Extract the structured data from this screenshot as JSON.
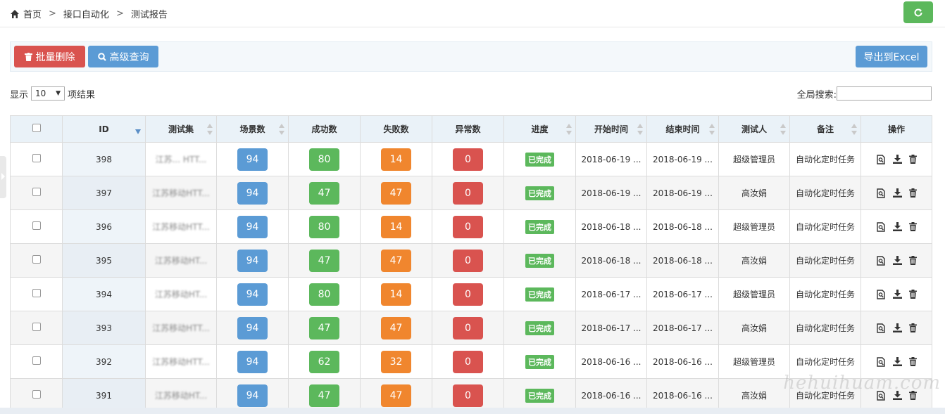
{
  "breadcrumb": {
    "home": "首页",
    "level1": "接口自动化",
    "level2": "测试报告",
    "separator": ">"
  },
  "toolbar": {
    "batch_delete": "批量删除",
    "advanced_query": "高级查询",
    "export_excel": "导出到Excel"
  },
  "length": {
    "prefix": "显示",
    "value": "10",
    "suffix": "项结果"
  },
  "search": {
    "label": "全局搜索:",
    "value": ""
  },
  "colors": {
    "blue": "#5b9bd5",
    "green": "#5cb85c",
    "orange": "#f0862e",
    "red": "#d9534f"
  },
  "table": {
    "headers": [
      "ID",
      "测试集",
      "场景数",
      "成功数",
      "失败数",
      "异常数",
      "进度",
      "开始时间",
      "结束时间",
      "测试人",
      "备注",
      "操作"
    ],
    "rows": [
      {
        "id": "398",
        "suite": "江苏... HTT...",
        "scenes": "94",
        "success": "80",
        "fail": "14",
        "error": "0",
        "status": "已完成",
        "start": "2018-06-19 ...",
        "end": "2018-06-19 ...",
        "tester": "超级管理员",
        "remark": "自动化定时任务"
      },
      {
        "id": "397",
        "suite": "江苏移动HTT...",
        "scenes": "94",
        "success": "47",
        "fail": "47",
        "error": "0",
        "status": "已完成",
        "start": "2018-06-19 ...",
        "end": "2018-06-19 ...",
        "tester": "高汝娟",
        "remark": "自动化定时任务"
      },
      {
        "id": "396",
        "suite": "江苏移动HTT...",
        "scenes": "94",
        "success": "80",
        "fail": "14",
        "error": "0",
        "status": "已完成",
        "start": "2018-06-18 ...",
        "end": "2018-06-18 ...",
        "tester": "超级管理员",
        "remark": "自动化定时任务"
      },
      {
        "id": "395",
        "suite": "江苏移动HT...",
        "scenes": "94",
        "success": "47",
        "fail": "47",
        "error": "0",
        "status": "已完成",
        "start": "2018-06-18 ...",
        "end": "2018-06-18 ...",
        "tester": "高汝娟",
        "remark": "自动化定时任务"
      },
      {
        "id": "394",
        "suite": "江苏移动HT...",
        "scenes": "94",
        "success": "80",
        "fail": "14",
        "error": "0",
        "status": "已完成",
        "start": "2018-06-17 ...",
        "end": "2018-06-17 ...",
        "tester": "超级管理员",
        "remark": "自动化定时任务"
      },
      {
        "id": "393",
        "suite": "江苏移动HTT...",
        "scenes": "94",
        "success": "47",
        "fail": "47",
        "error": "0",
        "status": "已完成",
        "start": "2018-06-17 ...",
        "end": "2018-06-17 ...",
        "tester": "高汝娟",
        "remark": "自动化定时任务"
      },
      {
        "id": "392",
        "suite": "江苏移动HTT...",
        "scenes": "94",
        "success": "62",
        "fail": "32",
        "error": "0",
        "status": "已完成",
        "start": "2018-06-16 ...",
        "end": "2018-06-16 ...",
        "tester": "超级管理员",
        "remark": "自动化定时任务"
      },
      {
        "id": "391",
        "suite": "江苏移动HT...",
        "scenes": "94",
        "success": "47",
        "fail": "47",
        "error": "0",
        "status": "已完成",
        "start": "2018-06-16 ...",
        "end": "2018-06-16 ...",
        "tester": "高汝娟",
        "remark": "自动化定时任务"
      }
    ]
  },
  "icons": {
    "home": "home-icon",
    "refresh": "refresh-icon",
    "trash": "trash-icon",
    "search": "search-icon",
    "view": "view-report-icon",
    "download": "download-icon",
    "delete": "delete-icon"
  },
  "watermark": "hehuihuam.com"
}
